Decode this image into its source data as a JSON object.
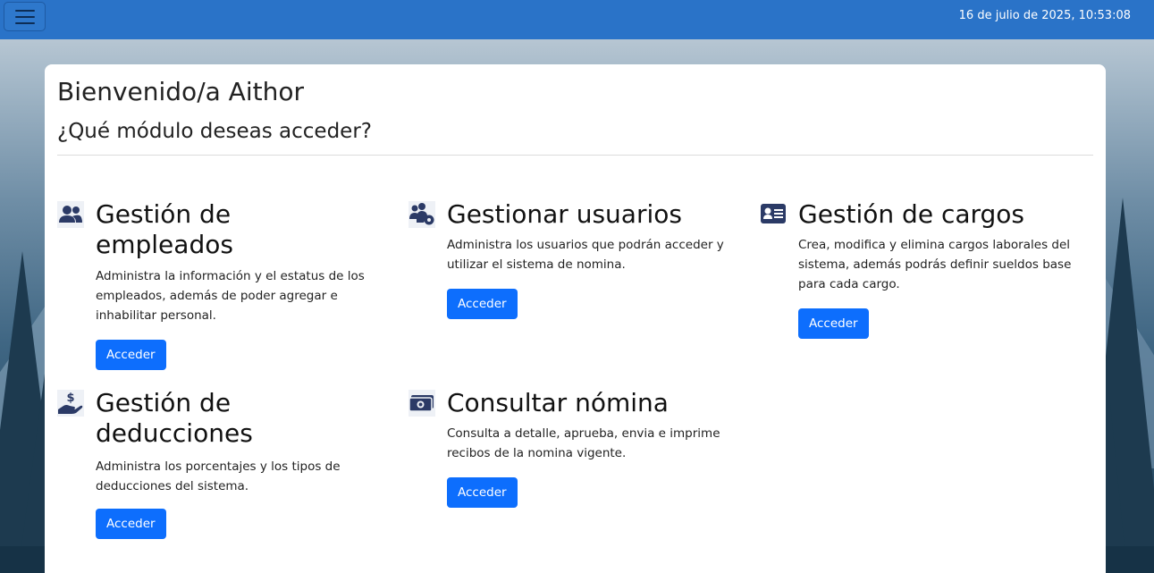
{
  "topbar": {
    "datetime": "16 de julio de 2025, 10:53:08",
    "menu_icon": "hamburger-menu-icon"
  },
  "welcome": {
    "title": "Bienvenido/a Aithor",
    "subtitle": "¿Qué módulo deseas acceder?"
  },
  "modules": [
    {
      "icon": "users-icon",
      "title_line1": "Gestión de",
      "title_line2": "empleados",
      "desc_line1": "Administra la información y el estatus de los",
      "desc_line2": "empleados, además de poder agregar e",
      "desc_line3": "inhabilitar personal.",
      "button": "Acceder"
    },
    {
      "icon": "users-gear-icon",
      "title_line1": "Gestionar usuarios",
      "desc_line1": "Administra los usuarios que podrán acceder y",
      "desc_line2": "utilizar el sistema de nomina.",
      "button": "Acceder"
    },
    {
      "icon": "id-card-icon",
      "title_line1": "Gestión de cargos",
      "desc_line1": "Crea, modifica y elimina cargos laborales del",
      "desc_line2": "sistema, además podrás definir sueldos base",
      "desc_line3": "para cada cargo.",
      "button": "Acceder"
    },
    {
      "icon": "hand-holding-dollar-icon",
      "title_line1": "Gestión de",
      "title_line2": "deducciones",
      "desc_line1": "Administra los porcentajes y los tipos de",
      "desc_line2": "deducciones del sistema.",
      "button": "Acceder"
    },
    {
      "icon": "money-bill-icon",
      "title_line1": "Consultar nómina",
      "desc_line1": "Consulta a detalle, aprueba, envia e imprime",
      "desc_line2": "recibos de la nomina vigente.",
      "button": "Acceder"
    }
  ],
  "colors": {
    "topbar": "#2a73c8",
    "button": "#0d6efd",
    "icon": "#2b3a66"
  }
}
